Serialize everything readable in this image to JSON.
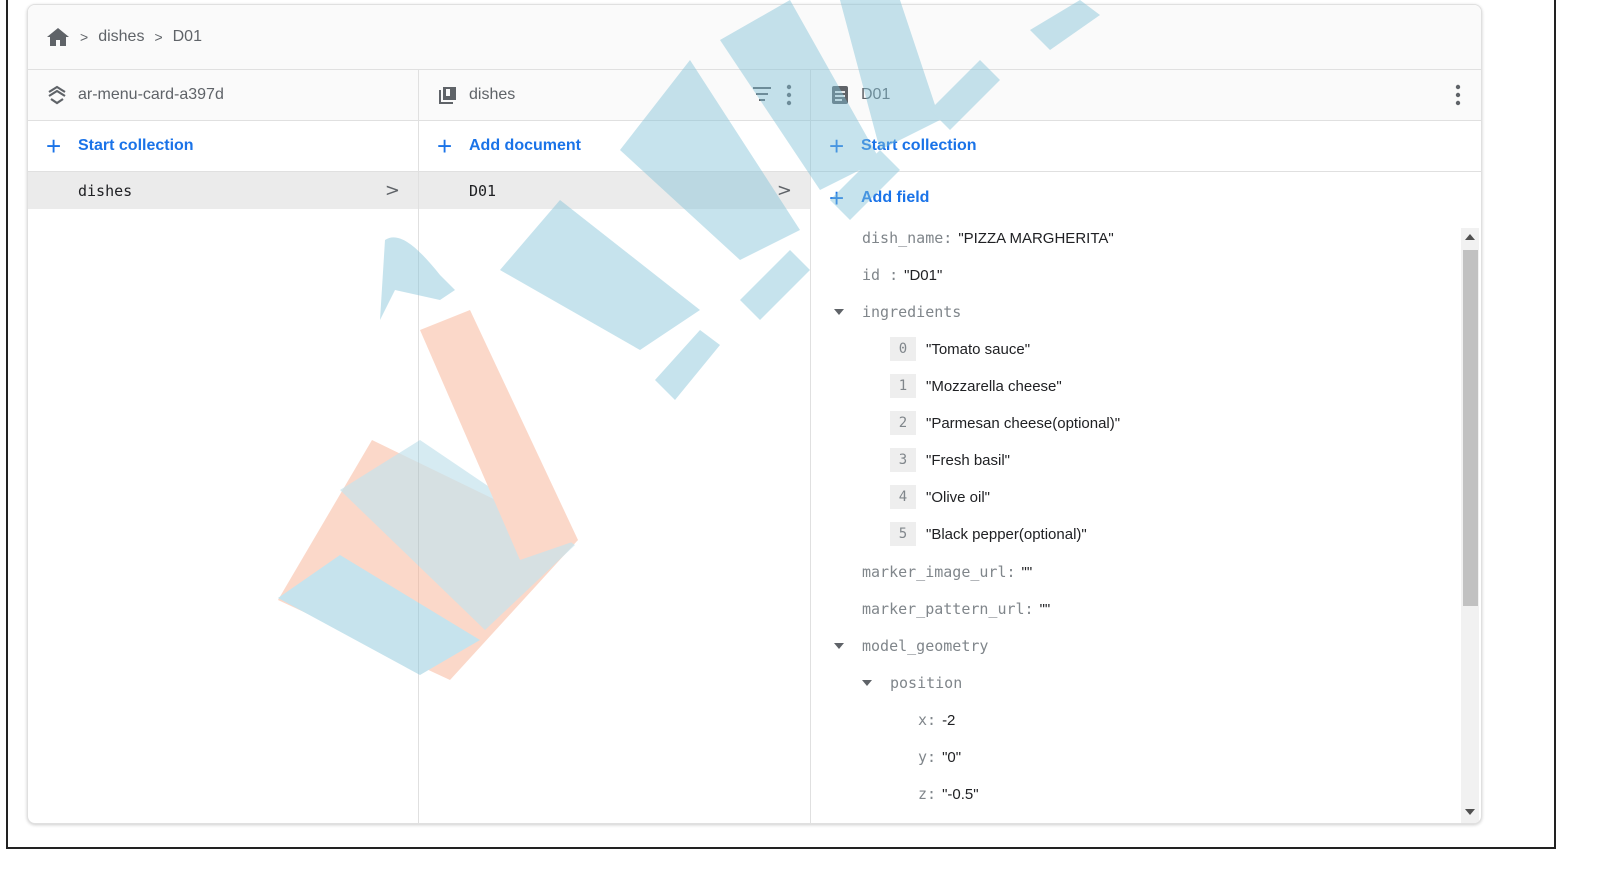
{
  "breadcrumb": {
    "home_icon": "home-icon",
    "items": [
      "dishes",
      "D01"
    ],
    "separator": ">"
  },
  "columns": {
    "project": {
      "icon": "firestore-layers-icon",
      "title": "ar-menu-card-a397d",
      "action": "Start collection",
      "items": [
        {
          "label": "dishes"
        }
      ]
    },
    "collection": {
      "icon": "collection-icon",
      "title": "dishes",
      "action": "Add document",
      "items": [
        {
          "label": "D01"
        }
      ]
    },
    "document": {
      "icon": "document-icon",
      "title": "D01",
      "action_collection": "Start collection",
      "action_field": "Add field",
      "fields": {
        "dish_name_key": "dish_name:",
        "dish_name_val": "\"PIZZA MARGHERITA\"",
        "id_key": "id :",
        "id_val": "\"D01\"",
        "ingredients_key": "ingredients",
        "ingredients": [
          {
            "index": "0",
            "value": "\"Tomato sauce\""
          },
          {
            "index": "1",
            "value": "\"Mozzarella cheese\""
          },
          {
            "index": "2",
            "value": "\"Parmesan cheese(optional)\""
          },
          {
            "index": "3",
            "value": "\"Fresh basil\""
          },
          {
            "index": "4",
            "value": "\"Olive oil\""
          },
          {
            "index": "5",
            "value": "\"Black pepper(optional)\""
          }
        ],
        "marker_image_key": "marker_image_url:",
        "marker_image_val": "\"\"",
        "marker_pattern_key": "marker_pattern_url:",
        "marker_pattern_val": "\"\"",
        "model_geometry_key": "model_geometry",
        "position_key": "position",
        "x_key": "x:",
        "x_val": "-2",
        "y_key": "y:",
        "y_val": "\"0\"",
        "z_key": "z:",
        "z_val": "\"-0.5\""
      }
    }
  },
  "colors": {
    "accent": "#1a73e8",
    "watermark_blue": "#7fc1d6",
    "watermark_orange": "#f7a887"
  }
}
